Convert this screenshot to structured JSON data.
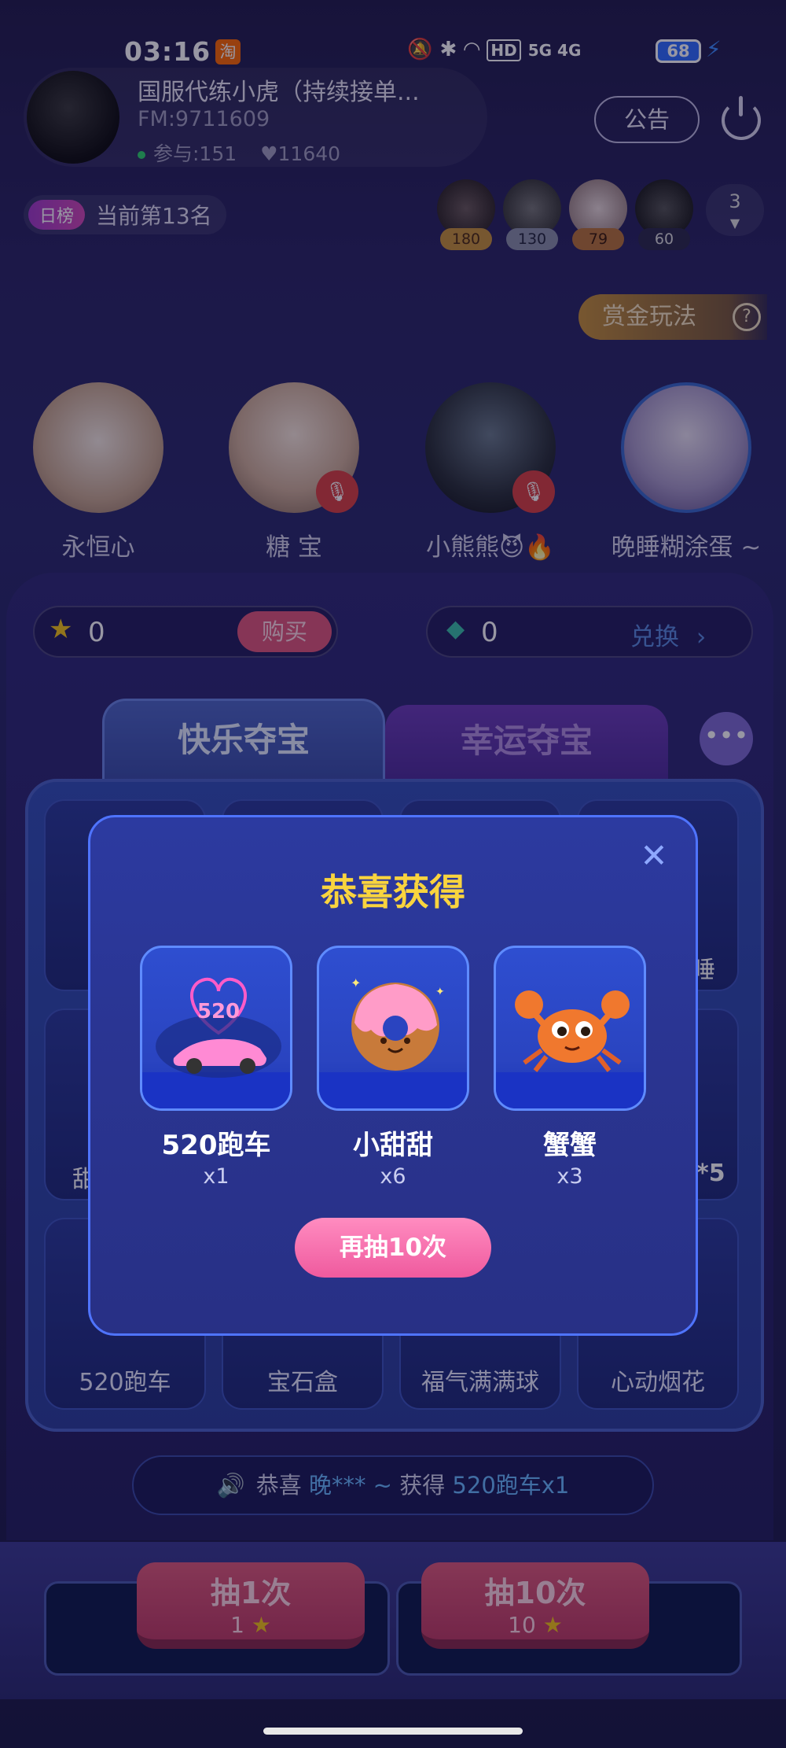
{
  "status_bar": {
    "time": "03:16",
    "app_badge": "淘",
    "network": "5G 4G",
    "hd": "HD",
    "battery": "68"
  },
  "room": {
    "host_name": "国服代练小虎（持续接单...",
    "fm": "FM:9711609",
    "participants": "参与:151",
    "likes": "11640",
    "notice_label": "公告",
    "rank_tag": "日榜",
    "rank_text": "当前第13名",
    "top_users": [
      {
        "score": "180",
        "badge_color": "#c7913a"
      },
      {
        "score": "130",
        "badge_color": "#8a8fa8"
      },
      {
        "score": "79",
        "badge_color": "#b8743a"
      },
      {
        "score": "60",
        "badge_color": "#2c2a4a"
      }
    ],
    "more_count": "3",
    "bounty_label": "赏金玩法",
    "help_mark": "?"
  },
  "seats": [
    {
      "name": "永恒心",
      "muted": false
    },
    {
      "name": "糖 宝",
      "muted": true
    },
    {
      "name": "小熊熊😈🔥",
      "muted": true
    },
    {
      "name": "晚睡糊涂蛋 ~",
      "muted": false
    }
  ],
  "wallet": {
    "stars": "0",
    "buy_label": "购买",
    "gems": "0",
    "exchange_label": "兑换"
  },
  "tabs": {
    "active": "快乐夺宝",
    "inactive": "幸运夺宝",
    "more": "•••"
  },
  "grid_visible_labels": {
    "row1_right": "睡",
    "row2_left": "甜",
    "row2_right": "*5"
  },
  "grid_bottom_row": [
    "520跑车",
    "宝石盒",
    "福气满满球",
    "心动烟花"
  ],
  "feed": {
    "prefix": "恭喜",
    "user": "晚*** ~",
    "mid": "获得",
    "prize": "520跑车x1"
  },
  "draw_buttons": [
    {
      "label": "抽1次",
      "cost": "1"
    },
    {
      "label": "抽10次",
      "cost": "10"
    }
  ],
  "modal": {
    "title": "恭喜获得",
    "prizes": [
      {
        "name": "520跑车",
        "qty": "x1",
        "art_text": "520"
      },
      {
        "name": "小甜甜",
        "qty": "x6"
      },
      {
        "name": "蟹蟹",
        "qty": "x3"
      }
    ],
    "again_label": "再抽10次"
  }
}
